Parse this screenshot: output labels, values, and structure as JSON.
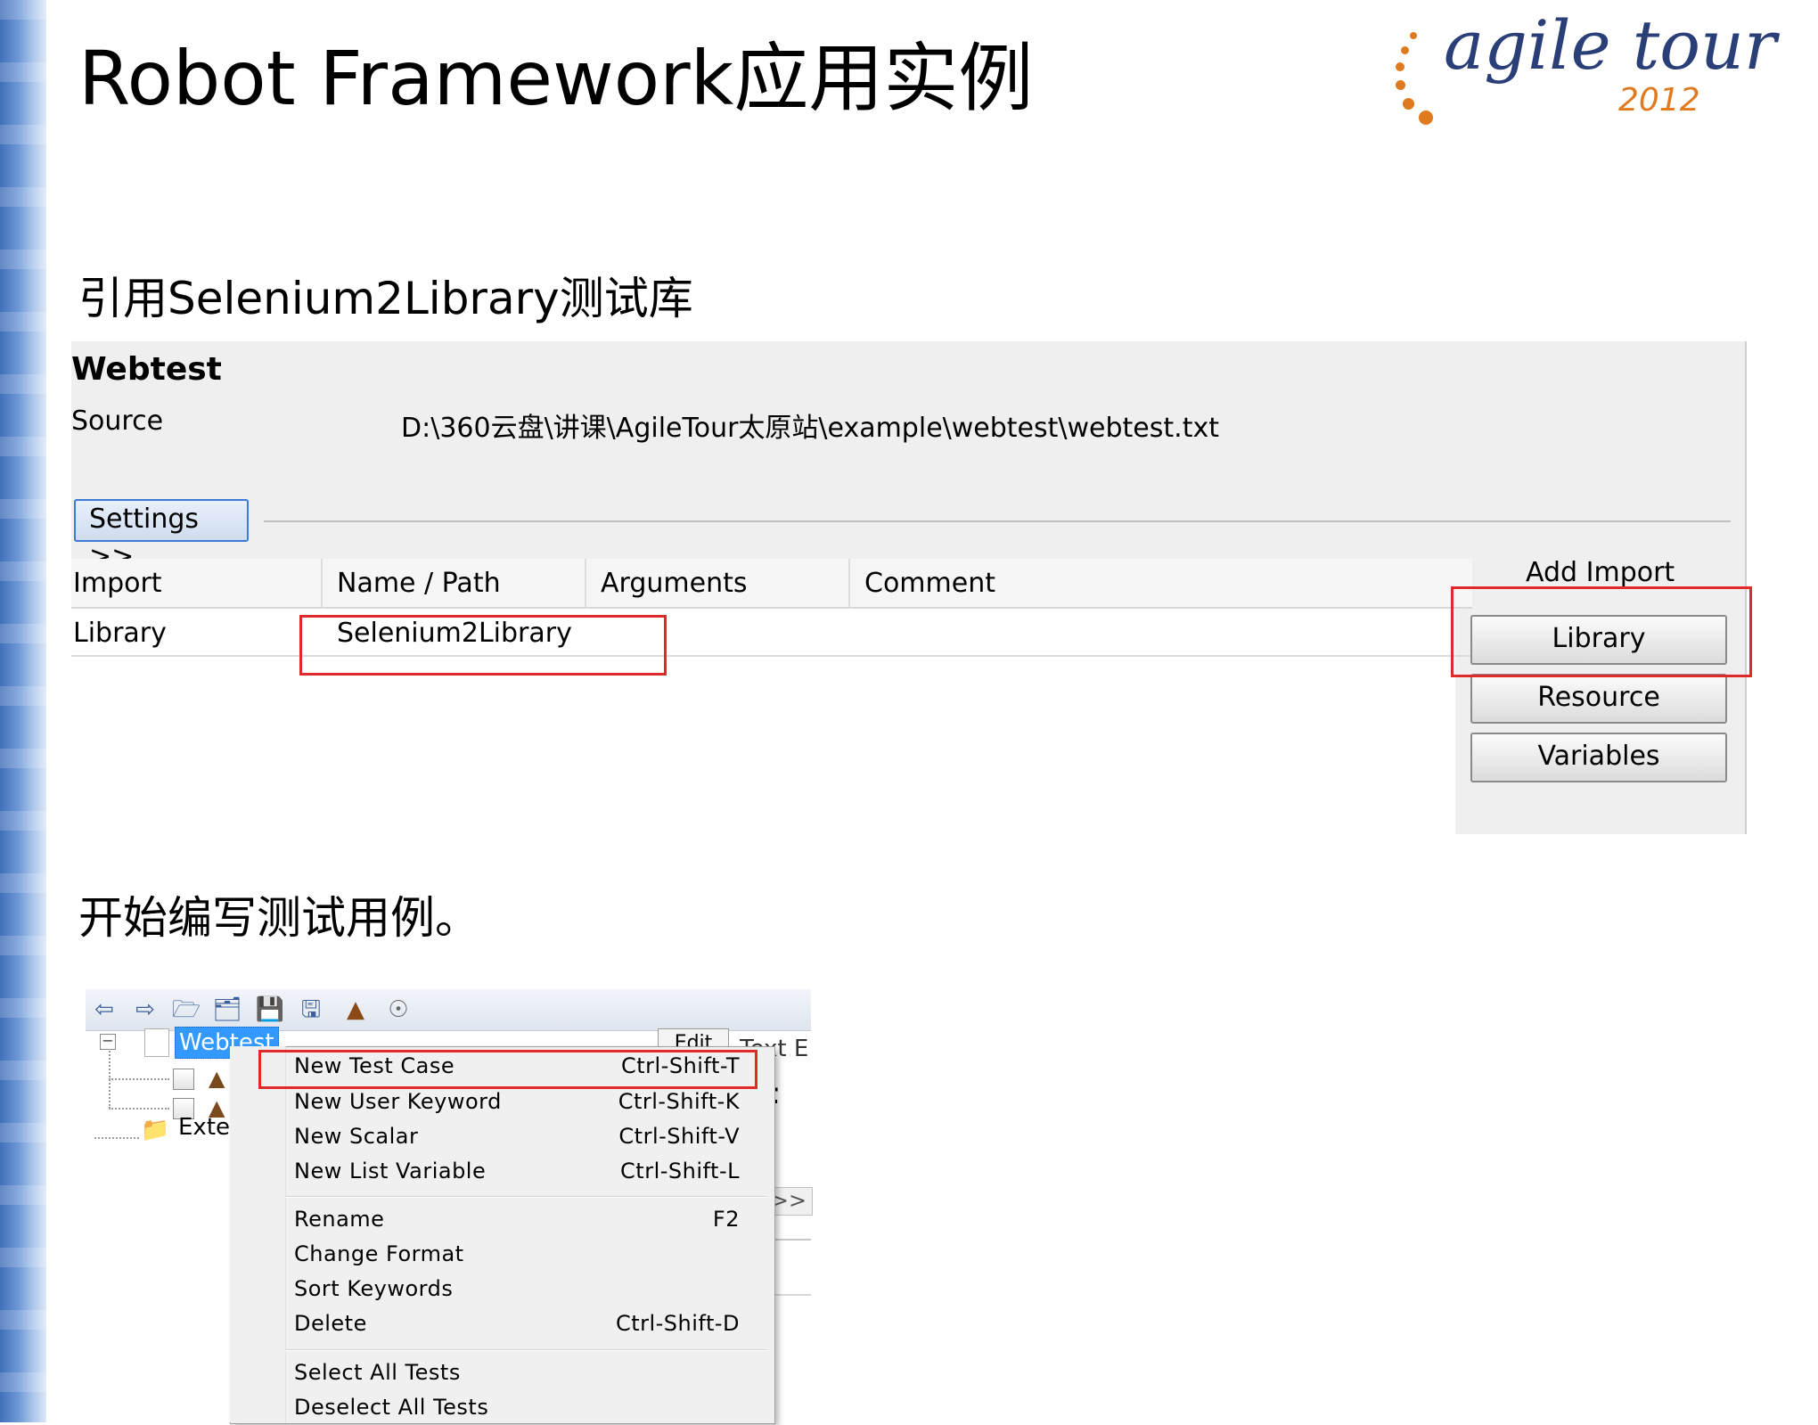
{
  "slide": {
    "title": "Robot Framework应用实例",
    "heading_1": "引用Selenium2Library测试库",
    "heading_2": "开始编写测试用例。"
  },
  "logo": {
    "text": "agile tour",
    "year": "2012",
    "colors": {
      "text": "#2a3f78",
      "year": "#e07a1f"
    }
  },
  "suite_panel": {
    "suite_name": "Webtest",
    "source_label": "Source",
    "source_path": "D:\\360云盘\\讲课\\AgileTour太原站\\example\\webtest\\webtest.txt",
    "settings_button": "Settings >>",
    "imports_table": {
      "columns": [
        "Import",
        "Name / Path",
        "Arguments",
        "Comment"
      ],
      "rows": [
        {
          "import": "Library",
          "name_path": "Selenium2Library",
          "arguments": "",
          "comment": ""
        }
      ]
    },
    "add_import": {
      "label": "Add Import",
      "buttons": [
        "Library",
        "Resource",
        "Variables"
      ]
    },
    "highlight_color": "#e02a2a"
  },
  "ride_tree": {
    "toolbar_icons": [
      "back-icon",
      "forward-icon",
      "open-directory-icon",
      "open-folder-icon",
      "save-icon",
      "save-all-icon",
      "run-icon",
      "stop-icon"
    ],
    "root_label": "Webtest",
    "external_label": "Exte",
    "tabs": {
      "edit": "Edit",
      "text": "Text E"
    },
    "peek_text": "t",
    "peek_arrows": ">>",
    "selection_color": "#3399ff"
  },
  "context_menu": {
    "groups": [
      [
        {
          "label": "New Test Case",
          "shortcut": "Ctrl-Shift-T"
        },
        {
          "label": "New User Keyword",
          "shortcut": "Ctrl-Shift-K"
        },
        {
          "label": "New Scalar",
          "shortcut": "Ctrl-Shift-V"
        },
        {
          "label": "New List Variable",
          "shortcut": "Ctrl-Shift-L"
        }
      ],
      [
        {
          "label": "Rename",
          "shortcut": "F2"
        },
        {
          "label": "Change Format",
          "shortcut": ""
        },
        {
          "label": "Sort Keywords",
          "shortcut": ""
        },
        {
          "label": "Delete",
          "shortcut": "Ctrl-Shift-D"
        }
      ],
      [
        {
          "label": "Select All Tests",
          "shortcut": ""
        },
        {
          "label": "Deselect All Tests",
          "shortcut": ""
        }
      ]
    ]
  }
}
